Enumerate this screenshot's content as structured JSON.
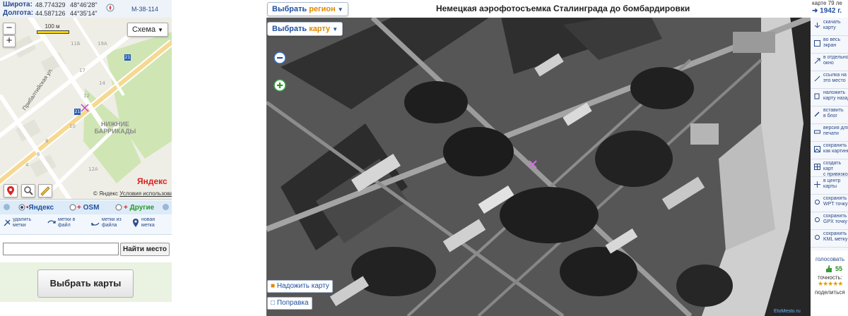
{
  "coords": {
    "lat_label": "Широта:",
    "lat_decimal": "48.774329",
    "lat_dms": "48°46'28\"",
    "lon_label": "Долгота:",
    "lon_decimal": "44.587126",
    "lon_dms": "44°35'14\"",
    "sheet": "M-38-114"
  },
  "minimap": {
    "scale_label": "100 м",
    "scheme_label": "Схема",
    "street": "Прибалтийская ул.",
    "district_line1": "НИЖНИЕ",
    "district_line2": "БАРРИКАДЫ",
    "house_numbers": [
      "11Б",
      "19А",
      "17",
      "14",
      "12",
      "10",
      "8",
      "6",
      "4",
      "12А",
      "21",
      "21"
    ],
    "logo": "Яндекс",
    "copyright": "© Яндекс",
    "terms": "Условия использования"
  },
  "providers": {
    "yandex": "Яндекс",
    "osm": "OSM",
    "other": "Другие"
  },
  "tools": {
    "t1_l1": "удалить",
    "t1_l2": "метки",
    "t2_l1": "метки в",
    "t2_l2": "файл",
    "t3_l1": "метки из",
    "t3_l2": "файла",
    "t4_l1": "новая",
    "t4_l2": "метка"
  },
  "search": {
    "value": "",
    "button": "Найти место"
  },
  "pick_maps": "Выбрать карты",
  "header": {
    "region_prefix": "Выбрать",
    "region_word": "регион",
    "title": "Немецкая аэрофотосъемка Сталинграда до бомбардировки",
    "map_prefix": "Выбрать",
    "map_word": "карту"
  },
  "map_buttons": {
    "bind_map": "Надожить карту",
    "correction": "Поправка",
    "watermark": "EtoMesto.ru"
  },
  "sidebar": {
    "map_age": "карте 79 ле",
    "year": "1942 г.",
    "items": [
      {
        "l1": "скачать",
        "l2": "карту"
      },
      {
        "l1": "во весь",
        "l2": "экран"
      },
      {
        "l1": "в отдельно",
        "l2": "окно"
      },
      {
        "l1": "ссылка на",
        "l2": "это место"
      },
      {
        "l1": "наложить",
        "l2": "карту назад"
      },
      {
        "l1": "вставить",
        "l2": "в блог"
      },
      {
        "l1": "версия для",
        "l2": "печати"
      },
      {
        "l1": "сохранить",
        "l2": "как картинк"
      },
      {
        "l1": "создать карт",
        "l2": "с привязкой"
      },
      {
        "l1": "в центр",
        "l2": "карты"
      },
      {
        "l1": "сохранить",
        "l2": "WPT точку"
      },
      {
        "l1": "сохранить",
        "l2": "GPX точку"
      },
      {
        "l1": "сохранить",
        "l2": "KML метку"
      }
    ],
    "vote_label": "голосовать",
    "votes": "55",
    "accuracy_label": "точность:",
    "share_label": "поделиться"
  },
  "colors": {
    "accent_blue": "#2250a0",
    "orange": "#e08a00",
    "osm_red": "#d22",
    "other_green": "#2a9a2a"
  }
}
